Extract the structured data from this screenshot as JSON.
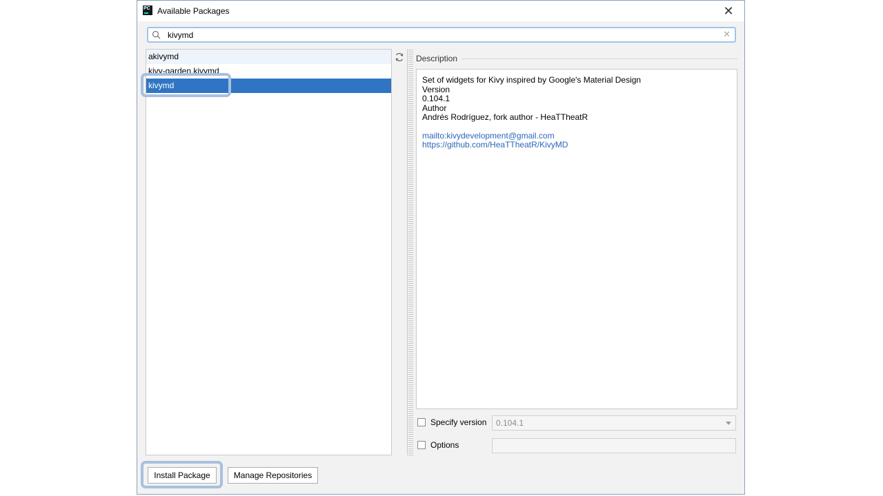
{
  "dialog": {
    "title": "Available Packages",
    "app_icon_text": "PC",
    "close_label": "✕"
  },
  "search": {
    "value": "kivymd",
    "clear_label": "✕"
  },
  "packages": [
    {
      "name": "akivymd",
      "state": "hover"
    },
    {
      "name": "kivy-garden.kivymd",
      "state": "normal"
    },
    {
      "name": "kivymd",
      "state": "selected"
    }
  ],
  "description": {
    "label": "Description",
    "summary": "Set of widgets for Kivy inspired by Google's Material Design",
    "version_label": "Version",
    "version": "0.104.1",
    "author_label": "Author",
    "author": "Andrés Rodríguez, fork author - HeaTTheatR",
    "links": [
      "mailto:kivydevelopment@gmail.com",
      "https://github.com/HeaTTheatR/KivyMD"
    ]
  },
  "options": {
    "specify_version_label": "Specify version",
    "specify_version_checked": false,
    "version_value": "0.104.1",
    "options_label": "Options",
    "options_checked": false,
    "options_value": ""
  },
  "buttons": {
    "install": "Install Package",
    "manage": "Manage Repositories"
  },
  "colors": {
    "selection": "#2f75c3",
    "highlight": "#a8c0de",
    "link": "#2a67b8"
  },
  "icons": {
    "search": "search-icon",
    "refresh": "refresh-icon",
    "close": "close-icon",
    "dropdown": "chevron-down-icon"
  }
}
